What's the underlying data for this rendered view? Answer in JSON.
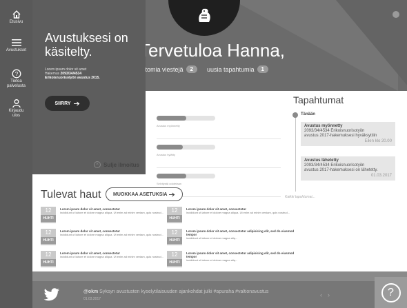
{
  "rail": {
    "home_label": "Etusivu",
    "menu_label": "Avustukset",
    "help_label_1": "Tietoa",
    "help_label_2": "palvelusta",
    "logout_label_1": "Kirjaudu",
    "logout_label_2": "ulos"
  },
  "header": {
    "welcome": "Tervetuloa Hanna,",
    "messages_text": "attomia viestejä",
    "messages_count": "2",
    "events_text": "uusia tapahtumia",
    "events_count": "1"
  },
  "notification": {
    "title": "Avustuksesi on käsitelty.",
    "body_line1": "Lorem ipsum dolor sit amet",
    "body_line2_prefix": "Hakemus ",
    "body_line2_id": "2093/34/4534",
    "body_line3": "Erikoisnuorisotyön avustus 2015.",
    "go_label": "SIIRRY",
    "close_label": "Sulje ilmoitus"
  },
  "stats": [
    {
      "caption": "Avustus myönnetty",
      "fill": 0.5
    },
    {
      "caption": "Avustus hylätty",
      "fill": 0.45
    },
    {
      "caption": "Selvitystä odotetaan",
      "fill": 0.5
    }
  ],
  "events": {
    "title": "Tapahtumat",
    "today": "Tänään",
    "items": [
      {
        "title": "Avustus myönnetty",
        "line1": "2093/34/4534 Erikoisnuorisotyön",
        "line2": "avustus 2017-hakemuksesi hyväksyttiin",
        "when": "Eilen klo 20.00"
      },
      {
        "title": "Avustus lähetetty",
        "line1": "2093/34/4534 Erikoisnuorisotyön",
        "line2": "avustus 2017-hakemuksesi on lähetetty.",
        "when": "01.03.2017"
      }
    ],
    "all_link": "Kaikki tapahtumat..."
  },
  "upcoming": {
    "title": "Tulevat haut",
    "edit_label": "MUOKKAA ASETUKSIA",
    "items": [
      {
        "day": "12",
        "month": "HUHTI",
        "title": "Lorem ipsum dolor sit amet, consectetur",
        "text": "incididunt ut labore et dolore magna aliqua. Ut enim ad minim veniam, quis nostrud..."
      },
      {
        "day": "12",
        "month": "HUHTI",
        "title": "Lorem ipsum dolor sit amet, consectetur",
        "text": "incididunt ut labore et dolore magna aliqua. Ut enim ad minim veniam, quis nostrud..."
      },
      {
        "day": "12",
        "month": "HUHTI",
        "title": "Lorem ipsum dolor sit amet, consectetur",
        "text": "incididunt ut labore et dolore magna aliqua. Ut enim ad minim veniam, quis nostrud..."
      },
      {
        "day": "12",
        "month": "HUHTI",
        "title": "Lorem ipsum dolor sit amet, consectetur",
        "text": "incididunt ut labore et dolore magna aliqua. Ut enim ad minim veniam, quis nostrud..."
      },
      {
        "day": "12",
        "month": "HUHTI",
        "title": "Lorem ipsum dolor sit amet, consectetur adipisicing elit, sed do eiusmod tempor",
        "text": "incididunt ut labore et dolore magna aliq..."
      },
      {
        "day": "12",
        "month": "HUHTI",
        "title": "Lorem ipsum dolor sit amet, consectetur adipisicing elit, sed do eiusmod tempor",
        "text": "incididunt ut labore et dolore magna aliq..."
      }
    ]
  },
  "footer": {
    "handle": "@okm",
    "tweet": "Syksyn avustusten kyselytilaisuuden ajankohdat julki #apuraha #valtionavustus",
    "date": "01.03.2017",
    "help_glyph": "?"
  }
}
